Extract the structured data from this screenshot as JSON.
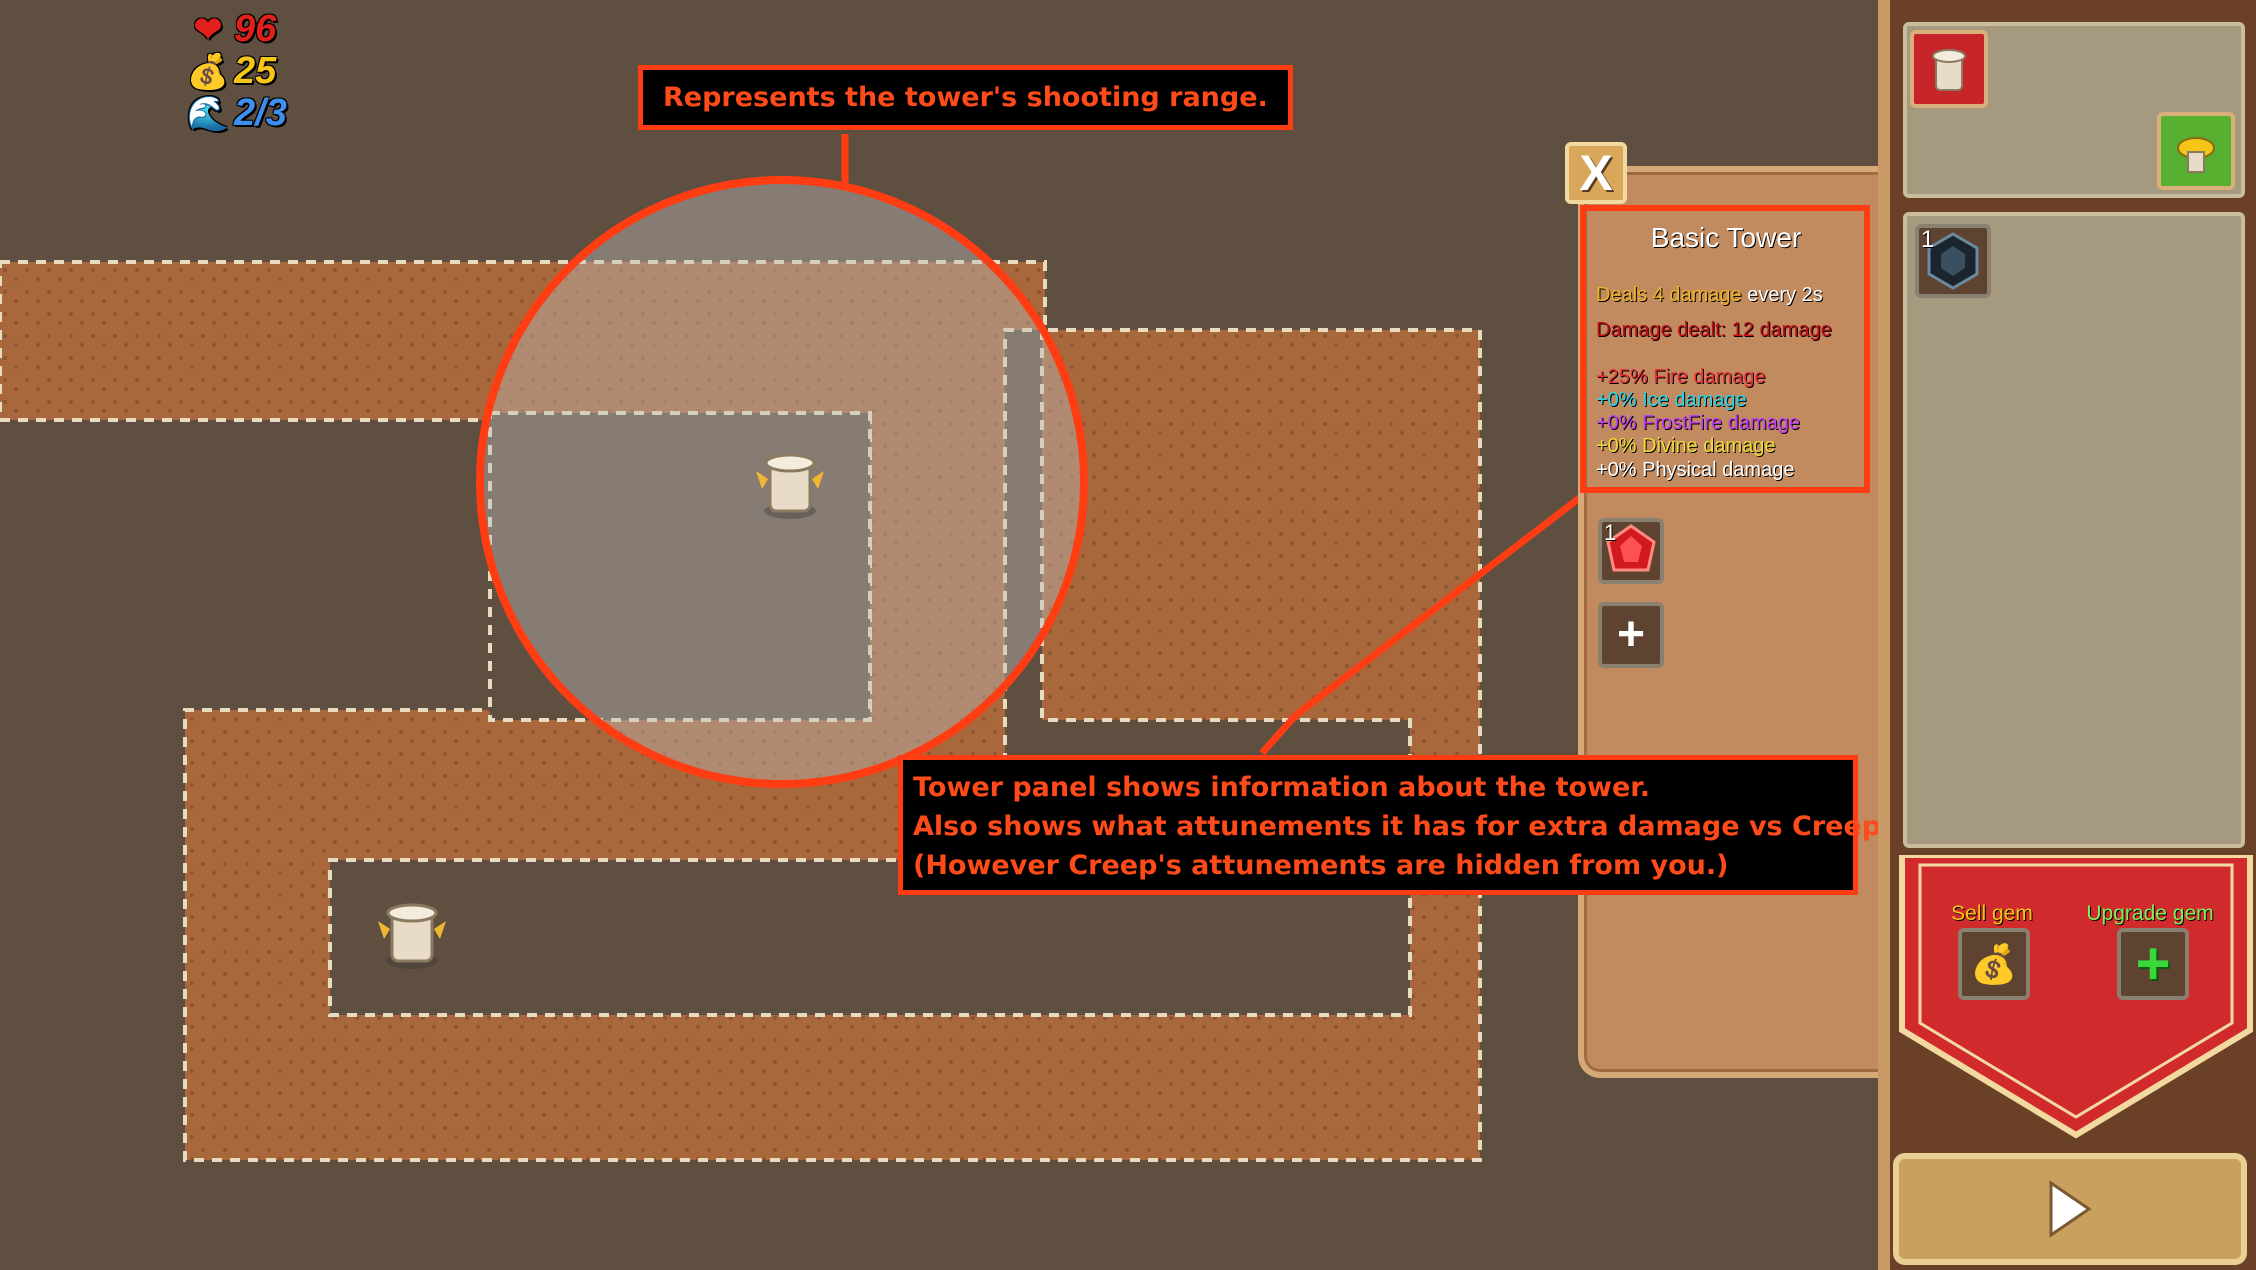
{
  "hud": {
    "lives": "96",
    "gold": "25",
    "wave": "2/3",
    "icons": [
      "heart-icon",
      "money-bag-icon",
      "wave-icon"
    ],
    "colors": {
      "lives": "#e2201b",
      "gold": "#f5c518",
      "wave": "#3d8ff0"
    }
  },
  "callouts": {
    "range": "Represents the tower's shooting range.",
    "panel_lines": [
      "Tower panel shows information about the tower.",
      "Also shows what attunements it has for extra damage vs Creeps.",
      "(However Creep's attunements are hidden from you.)"
    ]
  },
  "tower_panel": {
    "close_label": "X",
    "title": "Basic Tower",
    "deals_highlight": "Deals 4 damage",
    "deals_suffix": "every 2s",
    "damage_dealt": "Damage dealt: 12 damage",
    "attunements": [
      {
        "text": "+25% Fire damage",
        "color": "#e8333a"
      },
      {
        "text": "+0% Ice damage",
        "color": "#2ad4e8"
      },
      {
        "text": "+0% FrostFire damage",
        "color": "#c03cf0"
      },
      {
        "text": "+0% Divine damage",
        "color": "#f0dc3c"
      },
      {
        "text": "+0% Physical damage",
        "color": "#ffffff"
      }
    ],
    "gem_slot_count": "1",
    "add_gem_label": "+"
  },
  "sidebar": {
    "inventory_gem_count": "1",
    "sell_label": "Sell gem",
    "upgrade_label": "Upgrade gem",
    "upgrade_icon": "+",
    "play_icon": "play-icon"
  },
  "colors": {
    "accent": "#ff3c12",
    "dirt": "#a9683c",
    "ground": "#5f4f40"
  }
}
